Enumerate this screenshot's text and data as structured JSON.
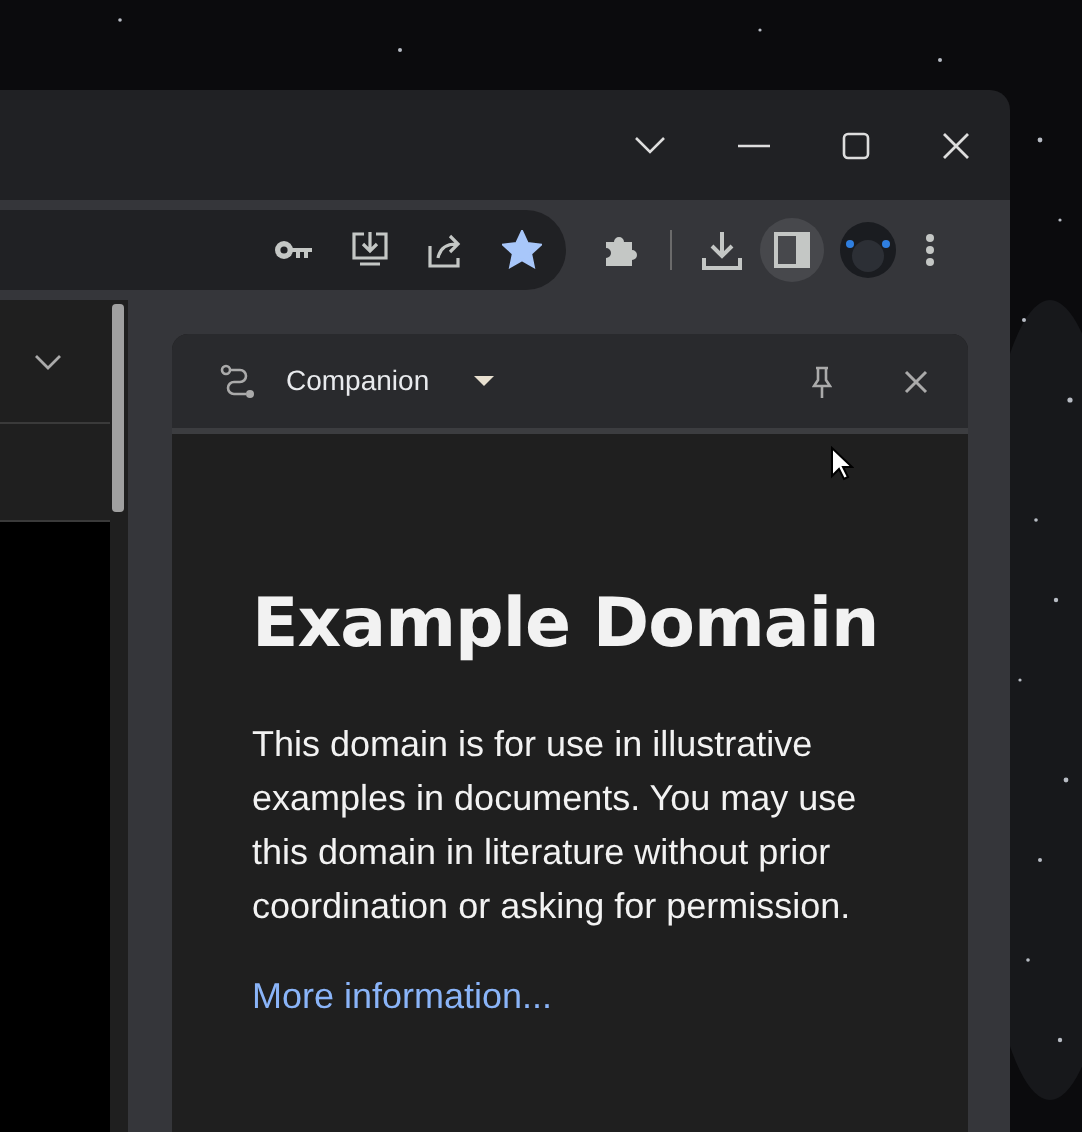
{
  "toolbar": {
    "bookmarked": true,
    "side_panel_open": true
  },
  "side_panel": {
    "title": "Companion",
    "page": {
      "heading": "Example Domain",
      "paragraph": "This domain is for use in illustrative examples in documents. You may use this domain in literature without prior coordination or asking for permission.",
      "link": "More information..."
    }
  }
}
